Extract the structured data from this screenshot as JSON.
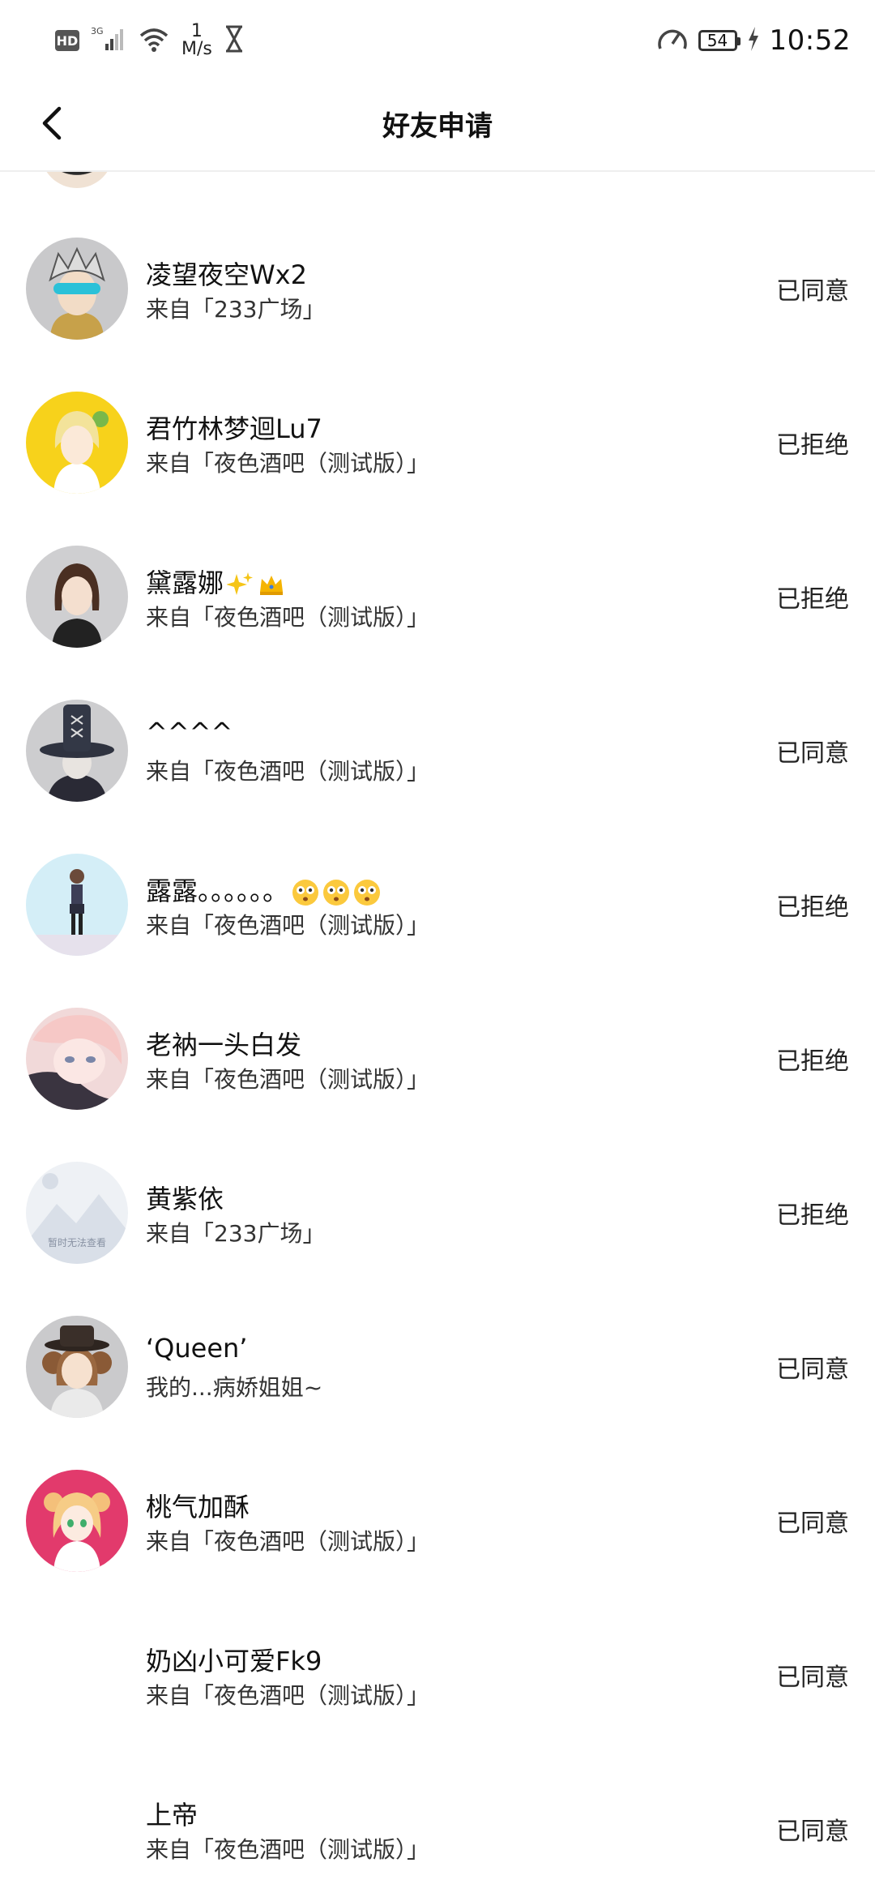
{
  "status_bar": {
    "hd": "HD",
    "network": "3G",
    "speed_value": "1",
    "speed_unit": "M/s",
    "battery": "54",
    "time": "10:52"
  },
  "header": {
    "title": "好友申请"
  },
  "requests": [
    {
      "name": "凌望夜空Wx2",
      "source": "来自「233广场」",
      "status": "已同意",
      "avatar": "cyber-boy-avatar"
    },
    {
      "name": "君竹林梦迴Lu7",
      "source": "来自「夜色酒吧（测试版）」",
      "status": "已拒绝",
      "avatar": "blonde-girl-avatar"
    },
    {
      "name": "黛露娜",
      "source": "来自「夜色酒吧（测试版）」",
      "status": "已拒绝",
      "avatar": "dark-hair-girl-avatar",
      "emojis": [
        "sparkles",
        "crown"
      ]
    },
    {
      "name": "^^^^",
      "source": "来自「夜色酒吧（测试版）」",
      "status": "已同意",
      "avatar": "hat-character-avatar"
    },
    {
      "name": "露露。。。。。。",
      "source": "来自「夜色酒吧（测试版）」",
      "status": "已拒绝",
      "avatar": "standing-girl-avatar",
      "emojis": [
        "flushed-face",
        "flushed-face",
        "flushed-face"
      ]
    },
    {
      "name": "老衲一头白发",
      "source": "来自「夜色酒吧（测试版）」",
      "status": "已拒绝",
      "avatar": "anime-face-avatar"
    },
    {
      "name": "黄紫依",
      "source": "来自「233广场」",
      "status": "已拒绝",
      "avatar": "placeholder-avatar",
      "avatar_text": "暂时无法查看"
    },
    {
      "name": "‘Queen’",
      "source": "我的...病娇姐姐~",
      "status": "已同意",
      "avatar": "brown-hair-girl-avatar"
    },
    {
      "name": "桃气加酥",
      "source": "来自「夜色酒吧（测试版）」",
      "status": "已同意",
      "avatar": "pink-bg-girl-avatar"
    },
    {
      "name": "奶凶小可爱Fk9",
      "source": "来自「夜色酒吧（测试版）」",
      "status": "已同意",
      "avatar": "blank-avatar"
    },
    {
      "name": "上帝",
      "source": "来自「夜色酒吧（测试版）」",
      "status": "已同意",
      "avatar": "blank-avatar"
    }
  ]
}
